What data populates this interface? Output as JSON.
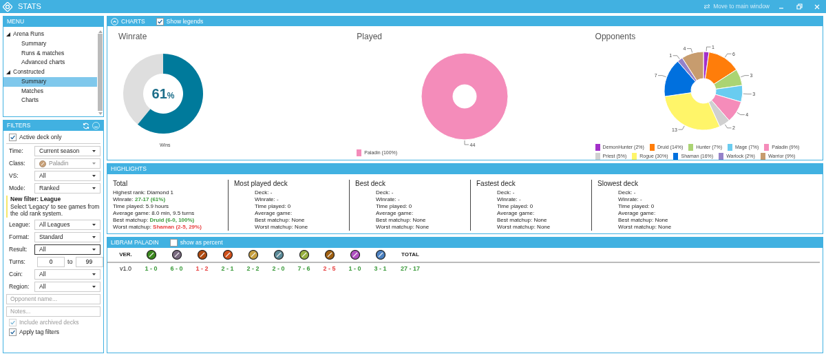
{
  "window": {
    "title": "STATS",
    "move_label": "Move to main window"
  },
  "menu": {
    "title": "MENU",
    "items": [
      {
        "label": "Arena Runs",
        "expanded": true,
        "selected": false,
        "children": [
          {
            "label": "Summary",
            "selected": false
          },
          {
            "label": "Runs & matches",
            "selected": false
          },
          {
            "label": "Advanced charts",
            "selected": false
          }
        ]
      },
      {
        "label": "Constructed",
        "expanded": true,
        "selected": false,
        "children": [
          {
            "label": "Summary",
            "selected": true
          },
          {
            "label": "Matches",
            "selected": false
          },
          {
            "label": "Charts",
            "selected": false
          }
        ]
      }
    ]
  },
  "filters": {
    "title": "FILTERS",
    "items": [
      {
        "kind": "check",
        "label": "Active deck only",
        "checked": true,
        "disabled": false
      },
      {
        "kind": "select",
        "label": "Time:",
        "value": "Current season",
        "disabled": false,
        "focused": false
      },
      {
        "kind": "select",
        "label": "Class:",
        "value": "Paladin",
        "icon": true,
        "disabled": true,
        "focused": false
      },
      {
        "kind": "select",
        "label": "VS:",
        "value": "All",
        "disabled": false,
        "focused": false
      },
      {
        "kind": "select",
        "label": "Mode:",
        "value": "Ranked",
        "disabled": false,
        "focused": false
      },
      {
        "kind": "note",
        "title": "New filter: League",
        "text": "Select 'Legacy' to see games from the old rank system."
      },
      {
        "kind": "select",
        "label": "League:",
        "value": "All Leagues",
        "disabled": false,
        "focused": false
      },
      {
        "kind": "select",
        "label": "Format:",
        "value": "Standard",
        "disabled": false,
        "focused": false
      },
      {
        "kind": "select",
        "label": "Result:",
        "value": "All",
        "disabled": false,
        "focused": true
      },
      {
        "kind": "range",
        "label": "Turns:",
        "from": "0",
        "joiner": "to",
        "to": "99"
      },
      {
        "kind": "select",
        "label": "Coin:",
        "value": "All",
        "disabled": false,
        "focused": false
      },
      {
        "kind": "select",
        "label": "Region:",
        "value": "All",
        "disabled": false,
        "focused": false
      },
      {
        "kind": "text",
        "placeholder": "Opponent name..."
      },
      {
        "kind": "text",
        "placeholder": "Notes..."
      },
      {
        "kind": "check",
        "label": "Include archived decks",
        "checked": true,
        "disabled": true
      },
      {
        "kind": "check",
        "label": "Apply tag filters",
        "checked": true,
        "disabled": false
      }
    ]
  },
  "charts": {
    "title": "CHARTS",
    "expanded": true,
    "show_legends": {
      "label": "Show legends",
      "checked": true
    },
    "winrate": {
      "title": "Winrate",
      "value": "61",
      "unit": "%",
      "legend": "Wins"
    },
    "played": {
      "chart_data": {
        "type": "donut",
        "title": "Played",
        "categories": [
          "Paladin"
        ],
        "values": [
          44
        ],
        "data_labels": true
      },
      "legend": [
        {
          "share": "(100%)",
          "color": "#f48cba"
        }
      ]
    },
    "opponents": {
      "chart_data": {
        "type": "donut",
        "title": "Opponents",
        "categories": [
          "DemonHunter",
          "Druid",
          "Hunter",
          "Mage",
          "Paladin",
          "Priest",
          "Rogue",
          "Shaman",
          "Warlock",
          "Warrior"
        ],
        "values": [
          1,
          6,
          3,
          3,
          4,
          2,
          13,
          7,
          1,
          4
        ],
        "data_labels": true
      },
      "legend": [
        {
          "share": "(2%)",
          "color": "#a330c9"
        },
        {
          "share": "(14%)",
          "color": "#ff7d0a"
        },
        {
          "share": "(7%)",
          "color": "#abd473"
        },
        {
          "share": "(7%)",
          "color": "#69ccf0"
        },
        {
          "share": "(9%)",
          "color": "#f58cba"
        },
        {
          "share": "(5%)",
          "color": "#d0d0d0"
        },
        {
          "share": "(30%)",
          "color": "#fff569"
        },
        {
          "share": "(16%)",
          "color": "#0070de"
        },
        {
          "share": "(2%)",
          "color": "#9482c9"
        },
        {
          "share": "(9%)",
          "color": "#c79c6e"
        }
      ]
    }
  },
  "highlights": {
    "title": "HIGHLIGHTS",
    "columns": [
      {
        "title": "Total",
        "kind": "summary",
        "lines": [
          {
            "label": "Highest rank:",
            "value": "Diamond 1"
          },
          {
            "label": "Winrate:",
            "value": "27-17 (61%)",
            "color": "#3a9a3a"
          },
          {
            "label": "Time played:",
            "value": "5.9 hours"
          },
          {
            "label": "Average game:",
            "value": "8.0 min, 9.5 turns"
          },
          {
            "label": "Best matchup:",
            "value": "Druid (6-0, 100%)",
            "color": "#3a9a3a"
          },
          {
            "label": "Worst matchup:",
            "value": "Shaman (2-5, 29%)",
            "color": "#e84040"
          }
        ]
      },
      {
        "title": "Most played deck",
        "kind": "deck",
        "lines": [
          {
            "label": "Deck:",
            "value": "-"
          },
          {
            "label": "Winrate:",
            "value": "-"
          },
          {
            "label": "Time played:",
            "value": "0"
          },
          {
            "label": "Average game:"
          },
          {
            "label": "Best matchup:",
            "value": "None"
          },
          {
            "label": "Worst matchup:",
            "value": "None"
          }
        ]
      },
      {
        "title": "Best deck",
        "kind": "deck",
        "lines": [
          {
            "label": "Deck:",
            "value": "-"
          },
          {
            "label": "Winrate:",
            "value": "-"
          },
          {
            "label": "Time played:",
            "value": "0"
          },
          {
            "label": "Average game:"
          },
          {
            "label": "Best matchup:",
            "value": "None"
          },
          {
            "label": "Worst matchup:",
            "value": "None"
          }
        ]
      },
      {
        "title": "Fastest deck",
        "kind": "deck",
        "lines": [
          {
            "label": "Deck:",
            "value": "-"
          },
          {
            "label": "Winrate:",
            "value": "-"
          },
          {
            "label": "Time played:",
            "value": "0"
          },
          {
            "label": "Average game:"
          },
          {
            "label": "Best matchup:",
            "value": "None"
          },
          {
            "label": "Worst matchup:",
            "value": "None"
          }
        ]
      },
      {
        "title": "Slowest deck",
        "kind": "deck",
        "lines": [
          {
            "label": "Deck:",
            "value": "-"
          },
          {
            "label": "Winrate:",
            "value": "-"
          },
          {
            "label": "Time played:",
            "value": "0"
          },
          {
            "label": "Average game:"
          },
          {
            "label": "Best matchup:",
            "value": "None"
          },
          {
            "label": "Worst matchup:",
            "value": "None"
          }
        ]
      }
    ]
  },
  "deck": {
    "title": "LIBRAM PALADIN",
    "show_percent": {
      "label": "show as percent",
      "checked": false
    },
    "columns": [
      {
        "kind": "label",
        "text": "VER."
      },
      {
        "kind": "class-icon",
        "color": "#3c8a1e"
      },
      {
        "kind": "class-icon",
        "color": "#7a6a80"
      },
      {
        "kind": "class-icon",
        "color": "#b04a10"
      },
      {
        "kind": "class-icon",
        "color": "#d0501a"
      },
      {
        "kind": "class-icon",
        "color": "#c8a040"
      },
      {
        "kind": "class-icon",
        "color": "#5a8a98"
      },
      {
        "kind": "class-icon",
        "color": "#98b040"
      },
      {
        "kind": "class-icon",
        "color": "#a06010"
      },
      {
        "kind": "class-icon",
        "color": "#b050c0"
      },
      {
        "kind": "class-icon",
        "color": "#4a80c0"
      },
      {
        "kind": "label",
        "text": "TOTAL"
      }
    ],
    "rows": [
      {
        "cells": [
          {
            "text": "v1.0"
          },
          {
            "text": "1 - 0",
            "color": "#3a9a3a"
          },
          {
            "text": "6 - 0",
            "color": "#3a9a3a"
          },
          {
            "text": "1 - 2",
            "color": "#e84040"
          },
          {
            "text": "2 - 1",
            "color": "#3a9a3a"
          },
          {
            "text": "2 - 2",
            "color": "#3a9a3a"
          },
          {
            "text": "2 - 0",
            "color": "#3a9a3a"
          },
          {
            "text": "7 - 6",
            "color": "#3a9a3a"
          },
          {
            "text": "2 - 5",
            "color": "#e84040"
          },
          {
            "text": "1 - 0",
            "color": "#3a9a3a"
          },
          {
            "text": "3 - 1",
            "color": "#3a9a3a"
          },
          {
            "text": "27 - 17",
            "color": "#3a9a3a"
          }
        ]
      }
    ]
  }
}
